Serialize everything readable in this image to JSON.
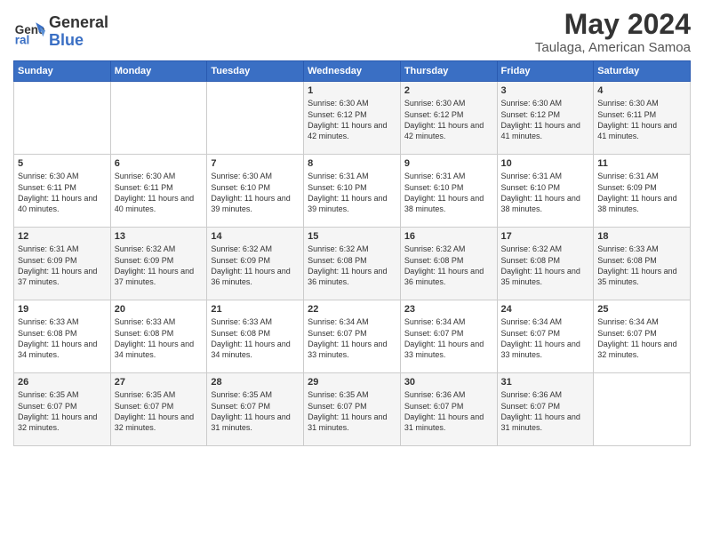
{
  "header": {
    "logo_line1": "General",
    "logo_line2": "Blue",
    "month": "May 2024",
    "location": "Taulaga, American Samoa"
  },
  "weekdays": [
    "Sunday",
    "Monday",
    "Tuesday",
    "Wednesday",
    "Thursday",
    "Friday",
    "Saturday"
  ],
  "weeks": [
    [
      {
        "day": "",
        "sunrise": "",
        "sunset": "",
        "daylight": ""
      },
      {
        "day": "",
        "sunrise": "",
        "sunset": "",
        "daylight": ""
      },
      {
        "day": "",
        "sunrise": "",
        "sunset": "",
        "daylight": ""
      },
      {
        "day": "1",
        "sunrise": "Sunrise: 6:30 AM",
        "sunset": "Sunset: 6:12 PM",
        "daylight": "Daylight: 11 hours and 42 minutes."
      },
      {
        "day": "2",
        "sunrise": "Sunrise: 6:30 AM",
        "sunset": "Sunset: 6:12 PM",
        "daylight": "Daylight: 11 hours and 42 minutes."
      },
      {
        "day": "3",
        "sunrise": "Sunrise: 6:30 AM",
        "sunset": "Sunset: 6:12 PM",
        "daylight": "Daylight: 11 hours and 41 minutes."
      },
      {
        "day": "4",
        "sunrise": "Sunrise: 6:30 AM",
        "sunset": "Sunset: 6:11 PM",
        "daylight": "Daylight: 11 hours and 41 minutes."
      }
    ],
    [
      {
        "day": "5",
        "sunrise": "Sunrise: 6:30 AM",
        "sunset": "Sunset: 6:11 PM",
        "daylight": "Daylight: 11 hours and 40 minutes."
      },
      {
        "day": "6",
        "sunrise": "Sunrise: 6:30 AM",
        "sunset": "Sunset: 6:11 PM",
        "daylight": "Daylight: 11 hours and 40 minutes."
      },
      {
        "day": "7",
        "sunrise": "Sunrise: 6:30 AM",
        "sunset": "Sunset: 6:10 PM",
        "daylight": "Daylight: 11 hours and 39 minutes."
      },
      {
        "day": "8",
        "sunrise": "Sunrise: 6:31 AM",
        "sunset": "Sunset: 6:10 PM",
        "daylight": "Daylight: 11 hours and 39 minutes."
      },
      {
        "day": "9",
        "sunrise": "Sunrise: 6:31 AM",
        "sunset": "Sunset: 6:10 PM",
        "daylight": "Daylight: 11 hours and 38 minutes."
      },
      {
        "day": "10",
        "sunrise": "Sunrise: 6:31 AM",
        "sunset": "Sunset: 6:10 PM",
        "daylight": "Daylight: 11 hours and 38 minutes."
      },
      {
        "day": "11",
        "sunrise": "Sunrise: 6:31 AM",
        "sunset": "Sunset: 6:09 PM",
        "daylight": "Daylight: 11 hours and 38 minutes."
      }
    ],
    [
      {
        "day": "12",
        "sunrise": "Sunrise: 6:31 AM",
        "sunset": "Sunset: 6:09 PM",
        "daylight": "Daylight: 11 hours and 37 minutes."
      },
      {
        "day": "13",
        "sunrise": "Sunrise: 6:32 AM",
        "sunset": "Sunset: 6:09 PM",
        "daylight": "Daylight: 11 hours and 37 minutes."
      },
      {
        "day": "14",
        "sunrise": "Sunrise: 6:32 AM",
        "sunset": "Sunset: 6:09 PM",
        "daylight": "Daylight: 11 hours and 36 minutes."
      },
      {
        "day": "15",
        "sunrise": "Sunrise: 6:32 AM",
        "sunset": "Sunset: 6:08 PM",
        "daylight": "Daylight: 11 hours and 36 minutes."
      },
      {
        "day": "16",
        "sunrise": "Sunrise: 6:32 AM",
        "sunset": "Sunset: 6:08 PM",
        "daylight": "Daylight: 11 hours and 36 minutes."
      },
      {
        "day": "17",
        "sunrise": "Sunrise: 6:32 AM",
        "sunset": "Sunset: 6:08 PM",
        "daylight": "Daylight: 11 hours and 35 minutes."
      },
      {
        "day": "18",
        "sunrise": "Sunrise: 6:33 AM",
        "sunset": "Sunset: 6:08 PM",
        "daylight": "Daylight: 11 hours and 35 minutes."
      }
    ],
    [
      {
        "day": "19",
        "sunrise": "Sunrise: 6:33 AM",
        "sunset": "Sunset: 6:08 PM",
        "daylight": "Daylight: 11 hours and 34 minutes."
      },
      {
        "day": "20",
        "sunrise": "Sunrise: 6:33 AM",
        "sunset": "Sunset: 6:08 PM",
        "daylight": "Daylight: 11 hours and 34 minutes."
      },
      {
        "day": "21",
        "sunrise": "Sunrise: 6:33 AM",
        "sunset": "Sunset: 6:08 PM",
        "daylight": "Daylight: 11 hours and 34 minutes."
      },
      {
        "day": "22",
        "sunrise": "Sunrise: 6:34 AM",
        "sunset": "Sunset: 6:07 PM",
        "daylight": "Daylight: 11 hours and 33 minutes."
      },
      {
        "day": "23",
        "sunrise": "Sunrise: 6:34 AM",
        "sunset": "Sunset: 6:07 PM",
        "daylight": "Daylight: 11 hours and 33 minutes."
      },
      {
        "day": "24",
        "sunrise": "Sunrise: 6:34 AM",
        "sunset": "Sunset: 6:07 PM",
        "daylight": "Daylight: 11 hours and 33 minutes."
      },
      {
        "day": "25",
        "sunrise": "Sunrise: 6:34 AM",
        "sunset": "Sunset: 6:07 PM",
        "daylight": "Daylight: 11 hours and 32 minutes."
      }
    ],
    [
      {
        "day": "26",
        "sunrise": "Sunrise: 6:35 AM",
        "sunset": "Sunset: 6:07 PM",
        "daylight": "Daylight: 11 hours and 32 minutes."
      },
      {
        "day": "27",
        "sunrise": "Sunrise: 6:35 AM",
        "sunset": "Sunset: 6:07 PM",
        "daylight": "Daylight: 11 hours and 32 minutes."
      },
      {
        "day": "28",
        "sunrise": "Sunrise: 6:35 AM",
        "sunset": "Sunset: 6:07 PM",
        "daylight": "Daylight: 11 hours and 31 minutes."
      },
      {
        "day": "29",
        "sunrise": "Sunrise: 6:35 AM",
        "sunset": "Sunset: 6:07 PM",
        "daylight": "Daylight: 11 hours and 31 minutes."
      },
      {
        "day": "30",
        "sunrise": "Sunrise: 6:36 AM",
        "sunset": "Sunset: 6:07 PM",
        "daylight": "Daylight: 11 hours and 31 minutes."
      },
      {
        "day": "31",
        "sunrise": "Sunrise: 6:36 AM",
        "sunset": "Sunset: 6:07 PM",
        "daylight": "Daylight: 11 hours and 31 minutes."
      },
      {
        "day": "",
        "sunrise": "",
        "sunset": "",
        "daylight": ""
      }
    ]
  ]
}
